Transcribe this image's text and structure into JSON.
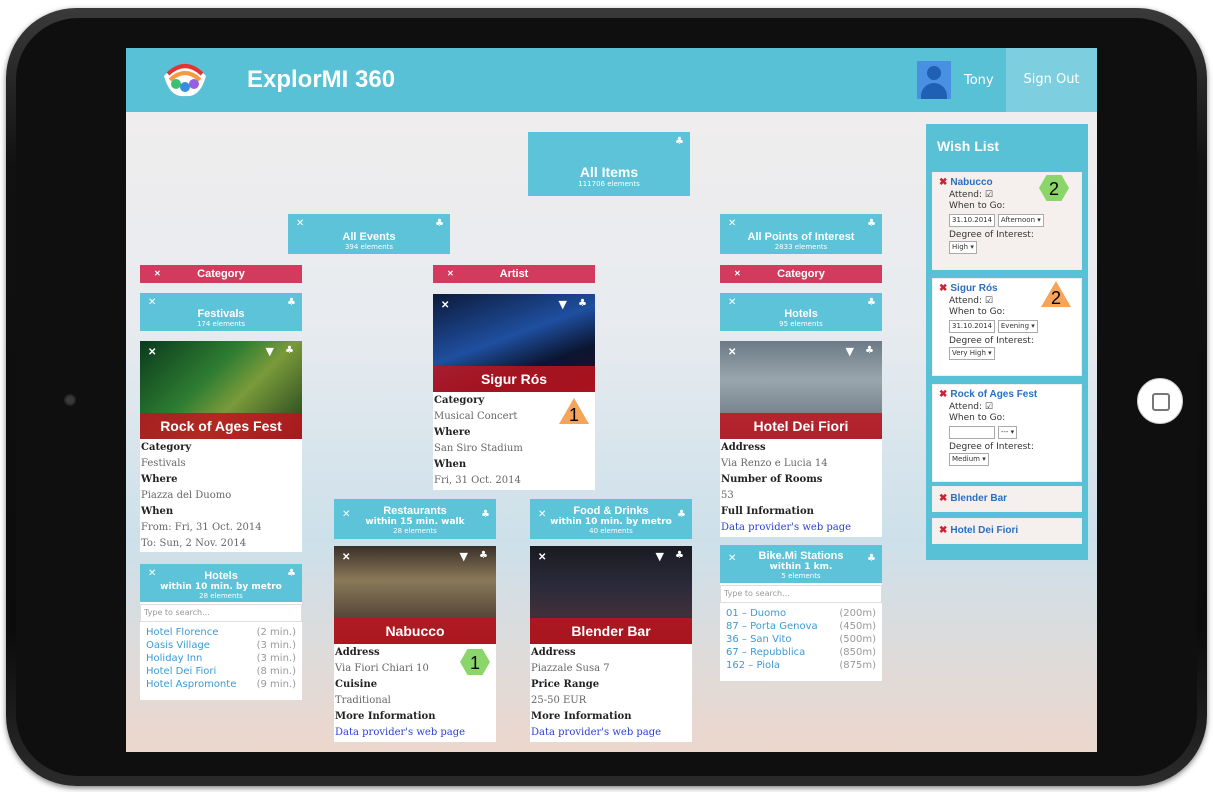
{
  "app": {
    "title": "ExplorMI 360",
    "user": "Tony",
    "sign_out": "Sign Out"
  },
  "root": {
    "title": "All Items",
    "count": "111706 elements"
  },
  "events": {
    "title": "All Events",
    "count": "394 elements"
  },
  "poi": {
    "title": "All Points of Interest",
    "count": "2833 elements"
  },
  "facets": {
    "left": "Category",
    "middle": "Artist",
    "right": "Category"
  },
  "festivals": {
    "title": "Festivals",
    "count": "174 elements"
  },
  "hotels": {
    "title": "Hotels",
    "count": "95 elements"
  },
  "rock": {
    "name": "Rock of Ages Fest",
    "cat_label": "Category",
    "cat": "Festivals",
    "where_label": "Where",
    "where": "Piazza del Duomo",
    "when_label": "When",
    "from": "From: Fri, 31 Oct. 2014",
    "to": "To: Sun, 2 Nov. 2014"
  },
  "sigur": {
    "name": "Sigur Rós",
    "cat_label": "Category",
    "cat": "Musical Concert",
    "where_label": "Where",
    "where": "San Siro Stadium",
    "when_label": "When",
    "when": "Fri, 31 Oct. 2014",
    "badge": "1"
  },
  "hoteldf": {
    "name": "Hotel Dei Fiori",
    "addr_label": "Address",
    "addr": "Via Renzo e Lucia 14",
    "rooms_label": "Number of Rooms",
    "rooms": "53",
    "info_label": "Full Information",
    "link": "Data provider's web page"
  },
  "hotels_metro": {
    "title": "Hotels",
    "sub": "within 10 min. by metro",
    "count": "28 elements",
    "placeholder": "Type to search...",
    "items": [
      {
        "name": "Hotel Florence",
        "dist": "(2 min.)"
      },
      {
        "name": "Oasis Village",
        "dist": "(3 min.)"
      },
      {
        "name": "Holiday Inn",
        "dist": "(3 min.)"
      },
      {
        "name": "Hotel Dei Fiori",
        "dist": "(8 min.)"
      },
      {
        "name": "Hotel Aspromonte",
        "dist": "(9 min.)"
      }
    ]
  },
  "restaurants": {
    "title": "Restaurants",
    "sub": "within 15 min. walk",
    "count": "28 elements"
  },
  "food": {
    "title": "Food & Drinks",
    "sub": "within 10 min. by metro",
    "count": "40 elements"
  },
  "bike": {
    "title": "Bike.Mi Stations",
    "sub": "within 1 km.",
    "count": "5 elements",
    "placeholder": "Type to search...",
    "items": [
      {
        "name": "01 – Duomo",
        "dist": "(200m)"
      },
      {
        "name": "87 – Porta Genova",
        "dist": "(450m)"
      },
      {
        "name": "36 – San Vito",
        "dist": "(500m)"
      },
      {
        "name": "67 – Repubblica",
        "dist": "(850m)"
      },
      {
        "name": "162 – Piola",
        "dist": "(875m)"
      }
    ]
  },
  "nabucco": {
    "name": "Nabucco",
    "addr_label": "Address",
    "addr": "Via Fiori Chiari 10",
    "cuisine_label": "Cuisine",
    "cuisine": "Traditional",
    "info_label": "More Information",
    "link": "Data provider's web page",
    "badge": "1"
  },
  "blender": {
    "name": "Blender Bar",
    "addr_label": "Address",
    "addr": "Piazzale Susa 7",
    "price_label": "Price Range",
    "price": "25-50 EUR",
    "info_label": "More Information",
    "link": "Data provider's web page"
  },
  "wishlist": {
    "title": "Wish List",
    "items": [
      {
        "name": "Nabucco",
        "attend": "Attend:",
        "when": "When to Go:",
        "date": "31.10.2014",
        "time": "Afternoon",
        "degree": "Degree of Interest:",
        "level": "High",
        "badge": "2"
      },
      {
        "name": "Sigur Rós",
        "attend": "Attend:",
        "when": "When to Go:",
        "date": "31.10.2014",
        "time": "Evening",
        "degree": "Degree of Interest:",
        "level": "Very High",
        "badge": "2"
      },
      {
        "name": "Rock of Ages Fest",
        "attend": "Attend:",
        "when": "When to Go:",
        "date": "",
        "time": "---",
        "degree": "Degree of Interest:",
        "level": "Medium"
      },
      {
        "name": "Blender Bar"
      },
      {
        "name": "Hotel Dei Fiori"
      }
    ]
  },
  "icons": {
    "close": "close-icon",
    "tree": "hierarchy-icon",
    "pin": "pin-icon"
  }
}
